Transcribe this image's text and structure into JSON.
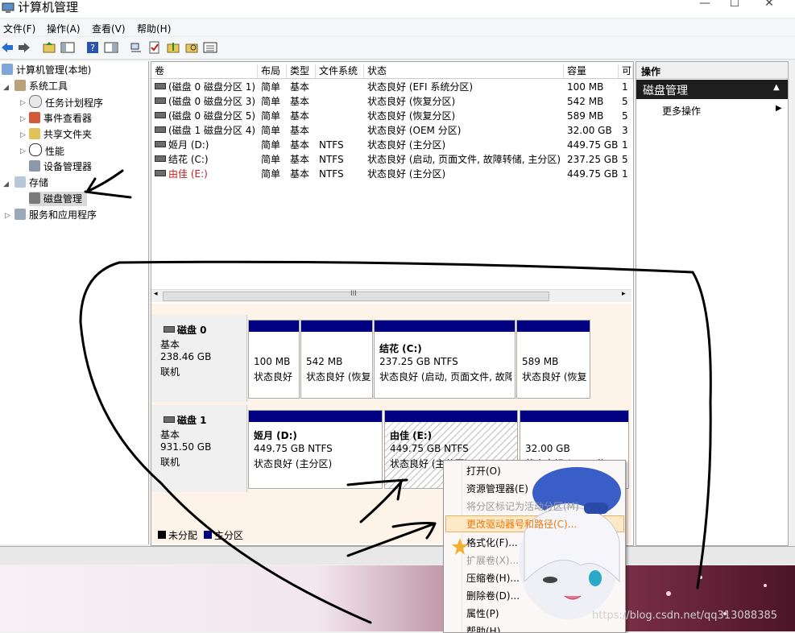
{
  "window": {
    "title": "计算机管理"
  },
  "menu": [
    "文件(F)",
    "操作(A)",
    "查看(V)",
    "帮助(H)"
  ],
  "tree": {
    "root": "计算机管理(本地)",
    "system_tools": "系统工具",
    "task_scheduler": "任务计划程序",
    "event_viewer": "事件查看器",
    "shared_folders": "共享文件夹",
    "performance": "性能",
    "device_manager": "设备管理器",
    "storage": "存储",
    "disk_management": "磁盘管理",
    "services_apps": "服务和应用程序"
  },
  "volumes": {
    "columns": [
      "卷",
      "布局",
      "类型",
      "文件系统",
      "状态",
      "容量",
      "可"
    ],
    "rows": [
      [
        "(磁盘 0 磁盘分区 1)",
        "简单",
        "基本",
        "",
        "状态良好 (EFI 系统分区)",
        "100 MB",
        "1"
      ],
      [
        "(磁盘 0 磁盘分区 3)",
        "简单",
        "基本",
        "",
        "状态良好 (恢复分区)",
        "542 MB",
        "5"
      ],
      [
        "(磁盘 0 磁盘分区 5)",
        "简单",
        "基本",
        "",
        "状态良好 (恢复分区)",
        "589 MB",
        "5"
      ],
      [
        "(磁盘 1 磁盘分区 4)",
        "简单",
        "基本",
        "",
        "状态良好 (OEM 分区)",
        "32.00 GB",
        "3"
      ],
      [
        "姬月 (D:)",
        "简单",
        "基本",
        "NTFS",
        "状态良好 (主分区)",
        "449.75 GB",
        "1"
      ],
      [
        "结花 (C:)",
        "简单",
        "基本",
        "NTFS",
        "状态良好 (启动, 页面文件, 故障转储, 主分区)",
        "237.25 GB",
        "5"
      ],
      [
        "由佳 (E:)",
        "简单",
        "基本",
        "NTFS",
        "状态良好 (主分区)",
        "449.75 GB",
        "1"
      ]
    ],
    "scroll_mid": "III"
  },
  "disk0": {
    "name": "磁盘 0",
    "type": "基本",
    "size": "238.46 GB",
    "status": "联机",
    "p1": {
      "size": "100 MB",
      "status": "状态良好"
    },
    "p2": {
      "size": "542 MB",
      "status": "状态良好 (恢复"
    },
    "p3": {
      "name": "结花  (C:)",
      "size": "237.25 GB NTFS",
      "status": "状态良好 (启动, 页面文件, 故障"
    },
    "p4": {
      "size": "589 MB",
      "status": "状态良好 (恢复"
    }
  },
  "disk1": {
    "name": "磁盘 1",
    "type": "基本",
    "size": "931.50 GB",
    "status": "联机",
    "p1": {
      "name": "姬月  (D:)",
      "size": "449.75 GB NTFS",
      "status": "状态良好 (主分区)"
    },
    "p2": {
      "name": "由佳  (E:)",
      "size": "449.75 GB NTFS",
      "status": "状态良好 (主分区)"
    },
    "p3": {
      "size": "32.00 GB",
      "status": "状态良好 (OEM 分"
    }
  },
  "legend": {
    "unallocated": "未分配",
    "primary": "主分区"
  },
  "actions": {
    "header": "操作",
    "section": "磁盘管理",
    "more": "更多操作"
  },
  "context_menu": [
    {
      "label": "打开(O)",
      "enabled": true
    },
    {
      "label": "资源管理器(E)",
      "enabled": true
    },
    {
      "label": "将分区标记为活动分区(M)",
      "enabled": false
    },
    {
      "label": "更改驱动器号和路径(C)...",
      "enabled": true
    },
    {
      "label": "格式化(F)...",
      "enabled": true
    },
    {
      "label": "扩展卷(X)...",
      "enabled": false
    },
    {
      "label": "压缩卷(H)...",
      "enabled": true
    },
    {
      "label": "删除卷(D)...",
      "enabled": true
    },
    {
      "label": "属性(P)",
      "enabled": true
    },
    {
      "label": "帮助(H)",
      "enabled": true
    }
  ],
  "watermark": "https://blog.csdn.net/qq313088385",
  "colors": {
    "primary_partition": "#000080",
    "unallocated": "#000000",
    "highlight": "#fde9c6",
    "annotation_ink": "#000000"
  }
}
